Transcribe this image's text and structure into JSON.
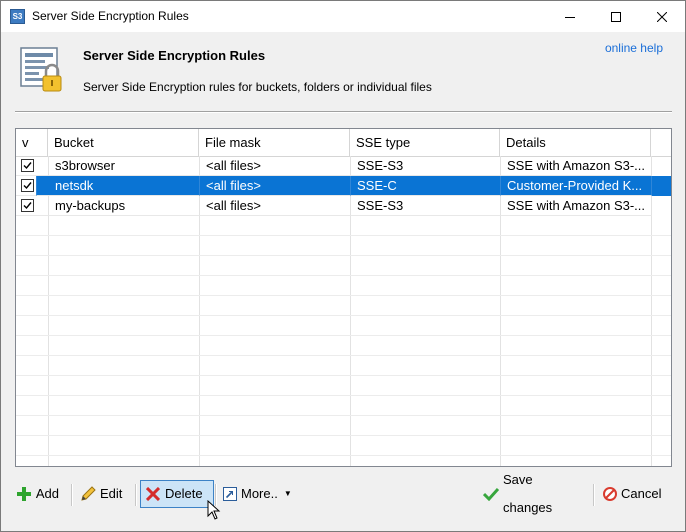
{
  "window": {
    "title": "Server Side Encryption Rules",
    "app_icon_text": "S3"
  },
  "header": {
    "title": "Server Side Encryption Rules",
    "subtitle": "Server Side Encryption rules for buckets, folders or individual files",
    "help_link": "online help"
  },
  "grid": {
    "columns": [
      "v",
      "Bucket",
      "File mask",
      "SSE type",
      "Details"
    ],
    "rows": [
      {
        "checked": true,
        "bucket": "s3browser",
        "mask": "<all files>",
        "sse": "SSE-S3",
        "details": "SSE with Amazon S3-...",
        "selected": false
      },
      {
        "checked": true,
        "bucket": "netsdk",
        "mask": "<all files>",
        "sse": "SSE-C",
        "details": "Customer-Provided K...",
        "selected": true
      },
      {
        "checked": true,
        "bucket": "my-backups",
        "mask": "<all files>",
        "sse": "SSE-S3",
        "details": "SSE with Amazon S3-...",
        "selected": false
      }
    ]
  },
  "toolbar": {
    "add_label": "Add",
    "edit_label": "Edit",
    "delete_label": "Delete",
    "more_label": "More..",
    "save_label": "Save changes",
    "cancel_label": "Cancel"
  },
  "icons": {
    "add": "plus-icon",
    "edit": "pencil-icon",
    "delete": "x-icon",
    "more": "arrow-box-icon",
    "save": "checkmark-icon",
    "cancel": "no-entry-icon"
  },
  "colors": {
    "selection": "#0a74d4",
    "link": "#1a6ed8",
    "add_green": "#2ea42e",
    "delete_red": "#d42c2c",
    "save_green": "#37a63d",
    "cancel_red": "#d93b2e"
  }
}
